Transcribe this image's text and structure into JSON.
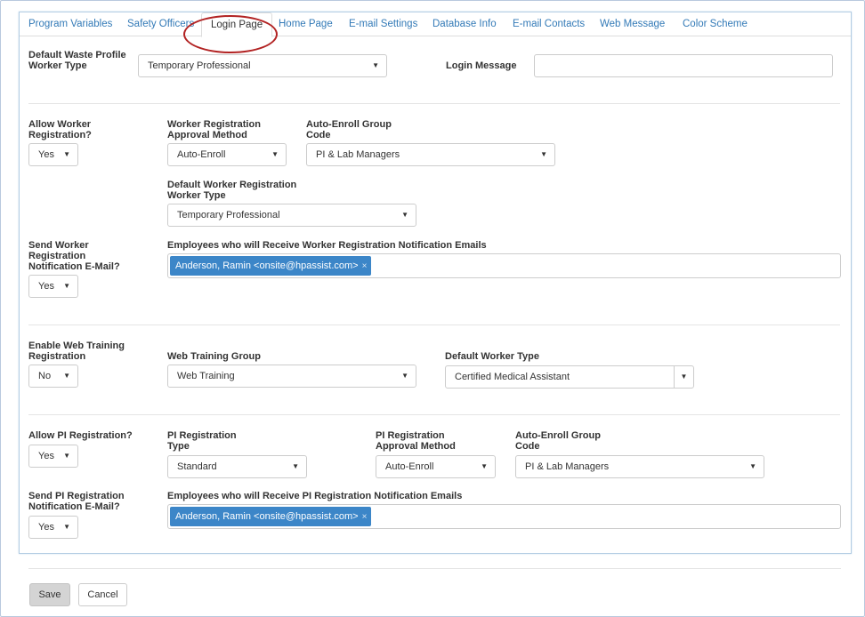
{
  "tabs": [
    {
      "label": "Program Variables"
    },
    {
      "label": "Safety Officers"
    },
    {
      "label": "Login Page"
    },
    {
      "label": "Home Page"
    },
    {
      "label": "E-mail Settings"
    },
    {
      "label": "Database Info"
    },
    {
      "label": "E-mail Contacts"
    },
    {
      "label": "Web Message"
    },
    {
      "label": "Color Scheme"
    }
  ],
  "login": {
    "waste_profile_label_1": "Default Waste Profile",
    "waste_profile_label_2": "Worker Type",
    "waste_profile_value": "Temporary Professional",
    "login_message_label": "Login Message",
    "login_message_value": ""
  },
  "worker_reg": {
    "allow_label_1": "Allow Worker",
    "allow_label_2": "Registration?",
    "allow_value": "Yes",
    "approval_label_1": "Worker Registration",
    "approval_label_2": "Approval Method",
    "approval_value": "Auto-Enroll",
    "group_label_1": "Auto-Enroll Group",
    "group_label_2": "Code",
    "group_value": "PI & Lab Managers",
    "default_type_label_1": "Default Worker Registration",
    "default_type_label_2": "Worker Type",
    "default_type_value": "Temporary Professional",
    "send_label_1": "Send Worker",
    "send_label_2": "Registration",
    "send_label_3": "Notification E-Mail?",
    "send_value": "Yes",
    "recipients_label": "Employees who will Receive Worker Registration Notification Emails",
    "recipients": [
      {
        "name": "Anderson, Ramin <onsite@hpassist.com>",
        "remove": "×"
      }
    ]
  },
  "web_training": {
    "enable_label_1": "Enable Web Training",
    "enable_label_2": "Registration",
    "enable_value": "No",
    "group_label": "Web Training Group",
    "group_value": "Web Training",
    "default_type_label": "Default Worker Type",
    "default_type_value": "Certified Medical Assistant"
  },
  "pi_reg": {
    "allow_label": "Allow PI Registration?",
    "allow_value": "Yes",
    "type_label_1": "PI Registration",
    "type_label_2": "Type",
    "type_value": "Standard",
    "approval_label_1": "PI Registration",
    "approval_label_2": "Approval Method",
    "approval_value": "Auto-Enroll",
    "group_label_1": "Auto-Enroll Group",
    "group_label_2": "Code",
    "group_value": "PI & Lab Managers",
    "send_label_1": "Send PI Registration",
    "send_label_2": "Notification E-Mail?",
    "send_value": "Yes",
    "recipients_label": "Employees who will Receive PI Registration Notification Emails",
    "recipients": [
      {
        "name": "Anderson, Ramin <onsite@hpassist.com>",
        "remove": "×"
      }
    ]
  },
  "actions": {
    "save_label": "Save",
    "cancel_label": "Cancel"
  },
  "icons": {
    "caret": "▼"
  },
  "colors": {
    "tab_link": "#337ab7",
    "chip": "#3c86c8",
    "highlight_ellipse": "#b22222"
  }
}
